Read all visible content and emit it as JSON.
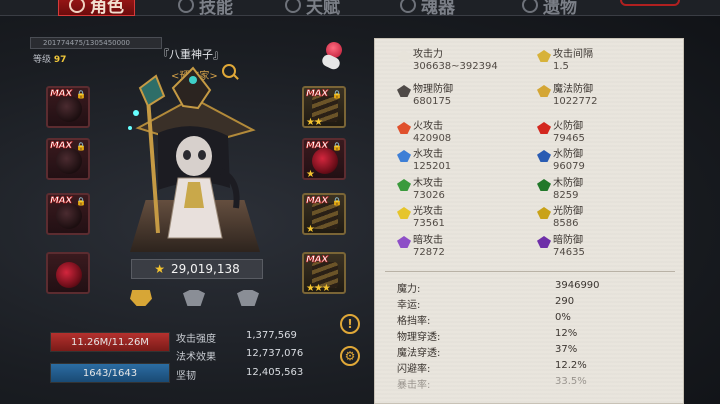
{
  "tabs": [
    {
      "label": "角色",
      "icon": "helmet-icon",
      "active": true
    },
    {
      "label": "技能",
      "icon": "skill-icon",
      "active": false
    },
    {
      "label": "天赋",
      "icon": "talent-icon",
      "active": false
    },
    {
      "label": "魂器",
      "icon": "soul-icon",
      "active": false
    },
    {
      "label": "遗物",
      "icon": "relic-icon",
      "active": false
    }
  ],
  "character": {
    "xp": "201774475/1305450000",
    "level_label": "等级",
    "level": "97",
    "name": "『八重神子』",
    "title": "<预言家>",
    "power": "29,019,138"
  },
  "equip_left": [
    {
      "label": "MAX",
      "type": "dark",
      "locked": true
    },
    {
      "label": "MAX",
      "type": "dark",
      "locked": true
    },
    {
      "label": "MAX",
      "type": "dark",
      "locked": true
    },
    {
      "label": "",
      "type": "red",
      "locked": false
    }
  ],
  "equip_right": [
    {
      "label": "MAX",
      "type": "gold",
      "locked": true,
      "stars": "★★"
    },
    {
      "label": "MAX",
      "type": "red",
      "locked": true,
      "stars": "★"
    },
    {
      "label": "MAX",
      "type": "gold",
      "locked": true,
      "stars": "★"
    },
    {
      "label": "MAX",
      "type": "gold",
      "locked": false,
      "stars": "★★★"
    }
  ],
  "bars": {
    "hp": "11.26M/11.26M",
    "mp": "1643/1643"
  },
  "left_stats": [
    {
      "label": "攻击强度",
      "value": "1,377,569"
    },
    {
      "label": "法术效果",
      "value": "12,737,076"
    },
    {
      "label": "坚韧",
      "value": "12,405,563"
    }
  ],
  "stats": [
    {
      "label": "攻击力",
      "value": "306638~392394",
      "icon": "sword-icon",
      "color": "#e7e3da"
    },
    {
      "label": "攻击间隔",
      "value": "1.5",
      "icon": "swords-icon",
      "color": "#d7b23a"
    },
    {
      "label": "物理防御",
      "value": "680175",
      "icon": "shield-icon",
      "color": "#4f4a47"
    },
    {
      "label": "魔法防御",
      "value": "1022772",
      "icon": "magic-shield-icon",
      "color": "#d4a635"
    },
    {
      "label": "火攻击",
      "value": "420908",
      "icon": "fire-attack-icon",
      "color": "#e0502c"
    },
    {
      "label": "火防御",
      "value": "79465",
      "icon": "fire-defense-icon",
      "color": "#d3271e"
    },
    {
      "label": "水攻击",
      "value": "125201",
      "icon": "water-attack-icon",
      "color": "#3e7fd6"
    },
    {
      "label": "水防御",
      "value": "96079",
      "icon": "water-defense-icon",
      "color": "#2a5cb3"
    },
    {
      "label": "木攻击",
      "value": "73026",
      "icon": "wood-attack-icon",
      "color": "#3b9a3c"
    },
    {
      "label": "木防御",
      "value": "8259",
      "icon": "wood-defense-icon",
      "color": "#22782a"
    },
    {
      "label": "光攻击",
      "value": "73561",
      "icon": "light-attack-icon",
      "color": "#e6c52b"
    },
    {
      "label": "光防御",
      "value": "8586",
      "icon": "light-defense-icon",
      "color": "#c9a218"
    },
    {
      "label": "暗攻击",
      "value": "72872",
      "icon": "dark-attack-icon",
      "color": "#8e4fc7"
    },
    {
      "label": "暗防御",
      "value": "74635",
      "icon": "dark-defense-icon",
      "color": "#6e2fa8"
    }
  ],
  "misc_stats": [
    {
      "label": "魔力:",
      "value": "3946990"
    },
    {
      "label": "幸运:",
      "value": "290"
    },
    {
      "label": "格挡率:",
      "value": "0%"
    },
    {
      "label": "物理穿透:",
      "value": "12%"
    },
    {
      "label": "魔法穿透:",
      "value": "37%"
    },
    {
      "label": "闪避率:",
      "value": "12.2%"
    },
    {
      "label": "暴击率:",
      "value": "33.5%"
    }
  ]
}
